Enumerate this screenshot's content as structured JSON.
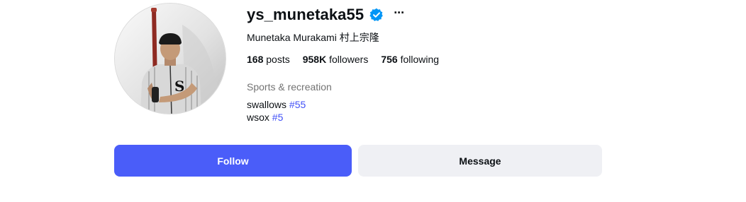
{
  "profile": {
    "username": "ys_munetaka55",
    "full_name": "Munetaka Murakami 村上宗隆",
    "verified": true,
    "more_label": "···",
    "stats": {
      "posts_count": "168",
      "posts_label": "posts",
      "followers_count": "958K",
      "followers_label": "followers",
      "following_count": "756",
      "following_label": "following"
    },
    "category": "Sports & recreation",
    "bio": [
      {
        "text": "swallows",
        "tag": "#55"
      },
      {
        "text": "wsox",
        "tag": "#5"
      }
    ]
  },
  "actions": {
    "follow_label": "Follow",
    "message_label": "Message"
  },
  "colors": {
    "accent": "#4a5df9",
    "verified": "#0095f6",
    "hashtag": "#4150f7",
    "secondary_text": "#737373",
    "message_bg": "#eff0f4"
  },
  "icons": {
    "verified": "verified-badge-icon",
    "more": "more-options-icon"
  }
}
